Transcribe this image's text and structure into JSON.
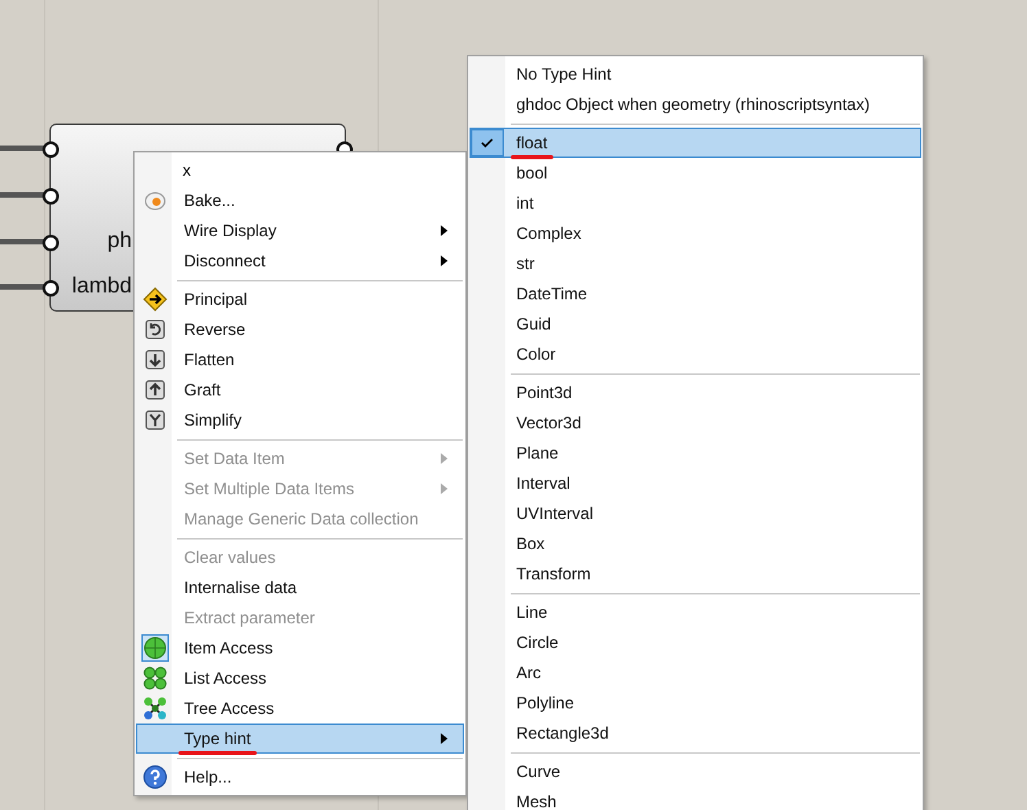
{
  "node": {
    "inputs": [
      {
        "connected": true
      },
      {
        "connected": true
      },
      {
        "connected": true,
        "label": "ph"
      },
      {
        "connected": true,
        "label": "lambd"
      }
    ]
  },
  "context_menu": {
    "field": {
      "value": "x"
    },
    "sections": [
      [
        {
          "label": "Bake...",
          "disabled": false,
          "selected": false,
          "submenu": false
        },
        {
          "label": "Wire Display",
          "disabled": false,
          "selected": false,
          "submenu": true
        },
        {
          "label": "Disconnect",
          "disabled": false,
          "selected": false,
          "submenu": true
        }
      ],
      [
        {
          "label": "Principal",
          "disabled": false,
          "selected": false,
          "submenu": false
        },
        {
          "label": "Reverse",
          "disabled": false,
          "selected": false,
          "submenu": false
        },
        {
          "label": "Flatten",
          "disabled": false,
          "selected": false,
          "submenu": false
        },
        {
          "label": "Graft",
          "disabled": false,
          "selected": false,
          "submenu": false
        },
        {
          "label": "Simplify",
          "disabled": false,
          "selected": false,
          "submenu": false
        }
      ],
      [
        {
          "label": "Set Data Item",
          "disabled": true,
          "selected": false,
          "submenu": true
        },
        {
          "label": "Set Multiple Data Items",
          "disabled": true,
          "selected": false,
          "submenu": true
        },
        {
          "label": "Manage Generic Data collection",
          "disabled": true,
          "selected": false,
          "submenu": false
        }
      ],
      [
        {
          "label": "Clear values",
          "disabled": true,
          "selected": false,
          "submenu": false
        },
        {
          "label": "Internalise data",
          "disabled": false,
          "selected": false,
          "submenu": false
        },
        {
          "label": "Extract parameter",
          "disabled": true,
          "selected": false,
          "submenu": false
        },
        {
          "label": "Item Access",
          "disabled": false,
          "selected": false,
          "submenu": false,
          "checked": true
        },
        {
          "label": "List Access",
          "disabled": false,
          "selected": false,
          "submenu": false,
          "checked": false
        },
        {
          "label": "Tree Access",
          "disabled": false,
          "selected": false,
          "submenu": false,
          "checked": false
        },
        {
          "label": "Type hint",
          "disabled": false,
          "selected": true,
          "submenu": true,
          "underlined": true
        }
      ],
      [
        {
          "label": "Help...",
          "disabled": false,
          "selected": false,
          "submenu": false
        }
      ]
    ]
  },
  "type_hint_menu": {
    "sections": [
      [
        {
          "label": "No Type Hint",
          "selected": false,
          "checked": false
        },
        {
          "label": "ghdoc Object when geometry (rhinoscriptsyntax)",
          "selected": false,
          "checked": false
        }
      ],
      [
        {
          "label": "float",
          "selected": true,
          "checked": true,
          "underlined": true
        },
        {
          "label": "bool",
          "selected": false,
          "checked": false
        },
        {
          "label": "int",
          "selected": false,
          "checked": false
        },
        {
          "label": "Complex",
          "selected": false,
          "checked": false
        },
        {
          "label": "str",
          "selected": false,
          "checked": false
        },
        {
          "label": "DateTime",
          "selected": false,
          "checked": false
        },
        {
          "label": "Guid",
          "selected": false,
          "checked": false
        },
        {
          "label": "Color",
          "selected": false,
          "checked": false
        }
      ],
      [
        {
          "label": "Point3d",
          "selected": false,
          "checked": false
        },
        {
          "label": "Vector3d",
          "selected": false,
          "checked": false
        },
        {
          "label": "Plane",
          "selected": false,
          "checked": false
        },
        {
          "label": "Interval",
          "selected": false,
          "checked": false
        },
        {
          "label": "UVInterval",
          "selected": false,
          "checked": false
        },
        {
          "label": "Box",
          "selected": false,
          "checked": false
        },
        {
          "label": "Transform",
          "selected": false,
          "checked": false
        }
      ],
      [
        {
          "label": "Line",
          "selected": false,
          "checked": false
        },
        {
          "label": "Circle",
          "selected": false,
          "checked": false
        },
        {
          "label": "Arc",
          "selected": false,
          "checked": false
        },
        {
          "label": "Polyline",
          "selected": false,
          "checked": false
        },
        {
          "label": "Rectangle3d",
          "selected": false,
          "checked": false
        }
      ],
      [
        {
          "label": "Curve",
          "selected": false,
          "checked": false
        },
        {
          "label": "Mesh",
          "selected": false,
          "checked": false
        }
      ]
    ]
  }
}
